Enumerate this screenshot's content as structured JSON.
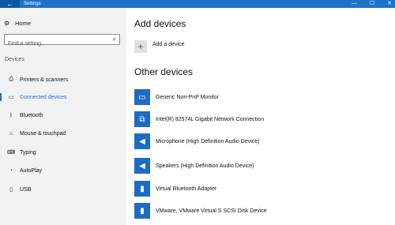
{
  "window": {
    "title": "Settings",
    "back_glyph": "←",
    "controls": [
      "—",
      "☐",
      "✕"
    ]
  },
  "sidebar": {
    "home_label": "Home",
    "search_placeholder": "Find a setting",
    "section_label": "Devices",
    "items": [
      {
        "label": "Printers & scanners",
        "icon": "printer-icon",
        "glyph": "⎙",
        "active": false
      },
      {
        "label": "Connected devices",
        "icon": "connected-devices-icon",
        "glyph": "▭",
        "active": true
      },
      {
        "label": "Bluetooth",
        "icon": "bluetooth-icon",
        "glyph": "ᛒ",
        "active": false
      },
      {
        "label": "Mouse & touchpad",
        "icon": "mouse-icon",
        "glyph": "⌂",
        "active": false
      },
      {
        "label": "Typing",
        "icon": "keyboard-icon",
        "glyph": "⌨",
        "active": false
      },
      {
        "label": "AutoPlay",
        "icon": "autoplay-icon",
        "glyph": "◔",
        "active": false
      },
      {
        "label": "USB",
        "icon": "usb-icon",
        "glyph": "▯",
        "active": false
      }
    ]
  },
  "main": {
    "add_heading": "Add devices",
    "add_label": "Add a device",
    "add_glyph": "+",
    "other_heading": "Other devices",
    "devices": [
      {
        "name": "Generic Non-PnP Monitor",
        "icon": "monitor-icon",
        "glyph": "▭"
      },
      {
        "name": "Intel(R) 82574L Gigabit Network Connection",
        "icon": "network-icon",
        "glyph": "⧉"
      },
      {
        "name": "Microphone (High Definition Audio Device)",
        "icon": "speaker-icon",
        "glyph": "◀"
      },
      {
        "name": "Speakers (High Definition Audio Device)",
        "icon": "speaker-icon",
        "glyph": "◀"
      },
      {
        "name": "Virtual Bluetooth Adapter",
        "icon": "usb-drive-icon",
        "glyph": "▮"
      },
      {
        "name": "VMware, VMware Virtual S SCSI Disk Device",
        "icon": "usb-drive-icon",
        "glyph": "▮"
      }
    ]
  },
  "colors": {
    "accent": "#1a6fd1",
    "titlebar": "#1e73c8",
    "tile": "#1c6cc4",
    "sidebar_bg": "#f2f2f2"
  }
}
